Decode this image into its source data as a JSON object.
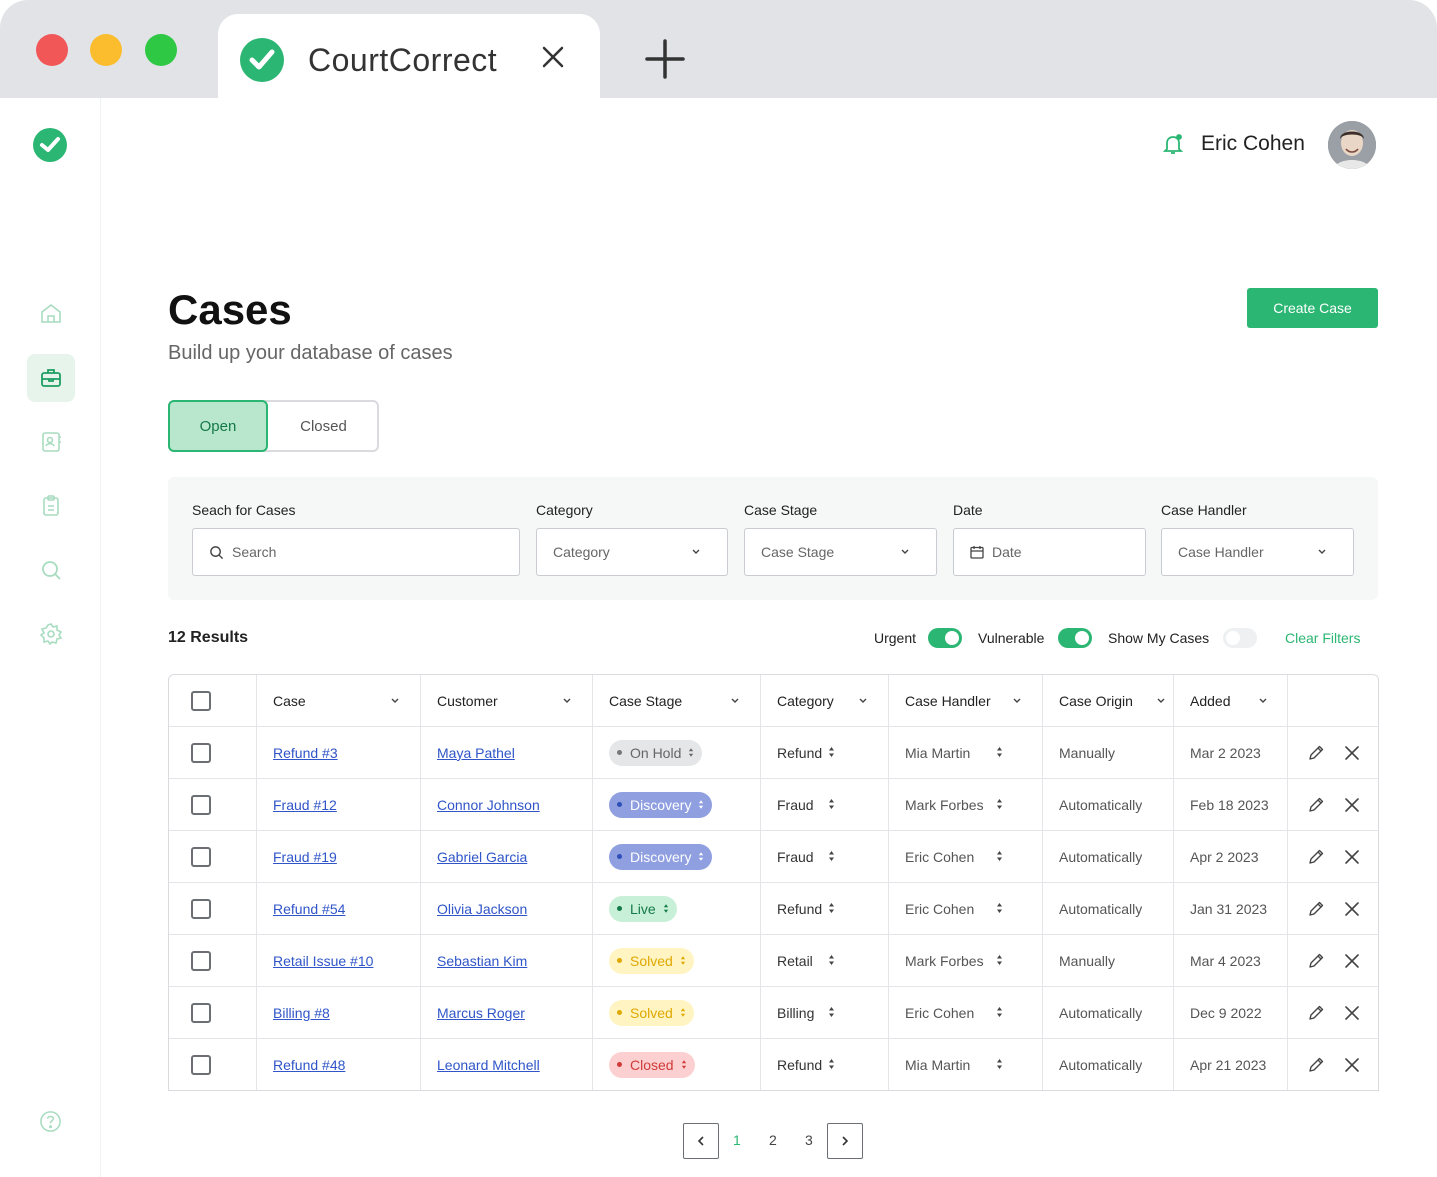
{
  "browser": {
    "tab_title": "CourtCorrect"
  },
  "header": {
    "user_name": "Eric Cohen"
  },
  "page": {
    "title": "Cases",
    "subtitle": "Build up your database of cases",
    "create_button": "Create Case"
  },
  "segmented": {
    "open": "Open",
    "closed": "Closed"
  },
  "filters": {
    "search_label": "Seach for Cases",
    "search_placeholder": "Search",
    "category_label": "Category",
    "category_value": "Category",
    "stage_label": "Case Stage",
    "stage_value": "Case Stage",
    "date_label": "Date",
    "date_value": "Date",
    "handler_label": "Case Handler",
    "handler_value": "Case Handler"
  },
  "results": {
    "count": "12 Results",
    "urgent": "Urgent",
    "urgent_on": true,
    "vulnerable": "Vulnerable",
    "vulnerable_on": true,
    "show_my": "Show My Cases",
    "show_my_on": false,
    "clear": "Clear Filters"
  },
  "table": {
    "headers": [
      "Case",
      "Customer",
      "Case Stage",
      "Category",
      "Case Handler",
      "Case Origin",
      "Added"
    ],
    "rows": [
      {
        "case": "Refund #3",
        "customer": "Maya Pathel",
        "stage": "On Hold",
        "category": "Refund",
        "handler": "Mia Martin",
        "origin": "Manually",
        "added": "Mar 2 2023"
      },
      {
        "case": "Fraud #12",
        "customer": "Connor Johnson",
        "stage": "Discovery",
        "category": "Fraud",
        "handler": "Mark Forbes",
        "origin": "Automatically",
        "added": "Feb 18 2023"
      },
      {
        "case": "Fraud #19",
        "customer": "Gabriel Garcia",
        "stage": "Discovery",
        "category": "Fraud",
        "handler": "Eric Cohen",
        "origin": "Automatically",
        "added": "Apr 2 2023"
      },
      {
        "case": "Refund #54",
        "customer": "Olivia Jackson",
        "stage": "Live",
        "category": "Refund",
        "handler": "Eric Cohen",
        "origin": "Automatically",
        "added": "Jan 31 2023"
      },
      {
        "case": "Retail Issue #10",
        "customer": "Sebastian Kim",
        "stage": "Solved",
        "category": "Retail",
        "handler": "Mark Forbes",
        "origin": "Manually",
        "added": "Mar 4 2023"
      },
      {
        "case": "Billing #8",
        "customer": "Marcus Roger",
        "stage": "Solved",
        "category": "Billing",
        "handler": "Eric Cohen",
        "origin": "Automatically",
        "added": "Dec 9 2022"
      },
      {
        "case": "Refund #48",
        "customer": "Leonard Mitchell",
        "stage": "Closed",
        "category": "Refund",
        "handler": "Mia Martin",
        "origin": "Automatically",
        "added": "Apr 21 2023"
      }
    ]
  },
  "stage_colors": {
    "On Hold": {
      "bg": "#e4e6e8",
      "fg": "#666666",
      "dot": "#777777"
    },
    "Discovery": {
      "bg": "#8f9fe0",
      "fg": "#ffffff",
      "dot": "#2f4fb8"
    },
    "Live": {
      "bg": "#c8f0d8",
      "fg": "#14794a",
      "dot": "#14794a"
    },
    "Solved": {
      "bg": "#fff4c2",
      "fg": "#e0a800",
      "dot": "#e0a800"
    },
    "Closed": {
      "bg": "#fcd0d0",
      "fg": "#d03a3a",
      "dot": "#d03a3a"
    }
  },
  "pagination": {
    "pages": [
      "1",
      "2",
      "3"
    ],
    "current": "1"
  }
}
